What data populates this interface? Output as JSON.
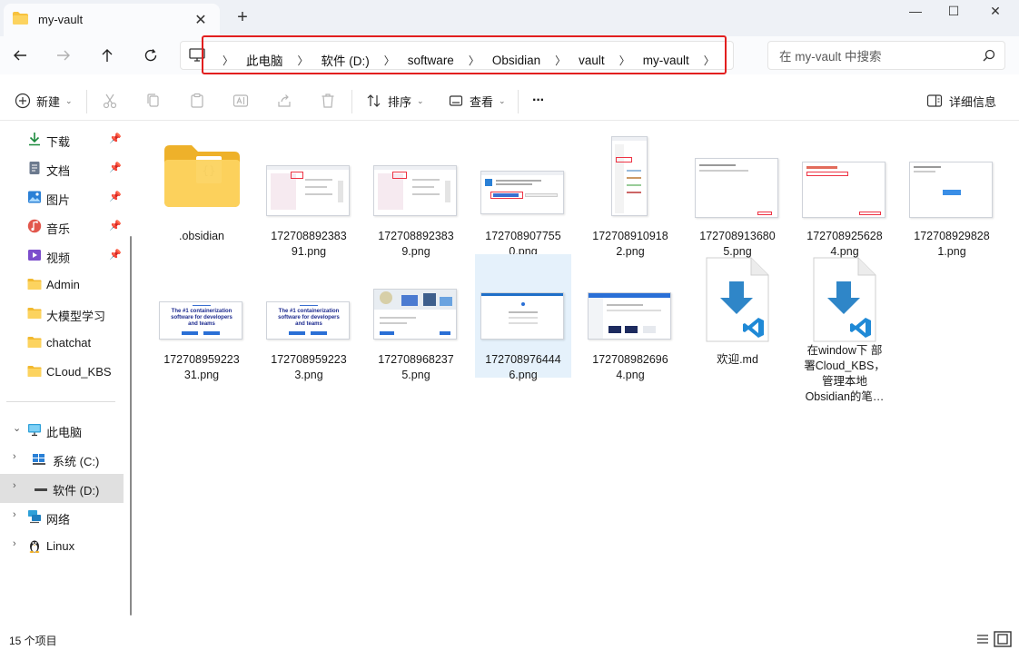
{
  "window": {
    "tab_title": "my-vault",
    "new_tab_symbol": "+",
    "close_symbol": "✕",
    "minimize_symbol": "—",
    "maximize_symbol": "☐"
  },
  "nav": {
    "back_icon": "arrow-left-icon",
    "forward_icon": "arrow-right-icon",
    "up_icon": "arrow-up-icon",
    "refresh_icon": "refresh-icon"
  },
  "breadcrumb": [
    "此电脑",
    "软件 (D:)",
    "software",
    "Obsidian",
    "vault",
    "my-vault"
  ],
  "search": {
    "placeholder": "在 my-vault 中搜索"
  },
  "toolbar": {
    "new_label": "新建",
    "sort_label": "排序",
    "view_label": "查看",
    "more_label": "···",
    "details_label": "详细信息"
  },
  "sidebar": {
    "quick_access": [
      {
        "label": "下载",
        "icon": "download-icon",
        "pinned": true
      },
      {
        "label": "文档",
        "icon": "document-icon",
        "pinned": true
      },
      {
        "label": "图片",
        "icon": "pictures-icon",
        "pinned": true
      },
      {
        "label": "音乐",
        "icon": "music-icon",
        "pinned": true
      },
      {
        "label": "视频",
        "icon": "video-icon",
        "pinned": true
      },
      {
        "label": "Admin",
        "icon": "folder-icon",
        "pinned": false
      },
      {
        "label": "大模型学习",
        "icon": "folder-icon",
        "pinned": false
      },
      {
        "label": "chatchat",
        "icon": "folder-icon",
        "pinned": false
      },
      {
        "label": "CLoud_KBS",
        "icon": "folder-icon",
        "pinned": false
      }
    ],
    "tree": [
      {
        "label": "此电脑",
        "icon": "computer-icon",
        "expanded": true
      },
      {
        "label": "系统 (C:)",
        "icon": "drive-icon"
      },
      {
        "label": "软件 (D:)",
        "icon": "drive-icon",
        "selected": true
      },
      {
        "label": "网络",
        "icon": "network-icon"
      },
      {
        "label": "Linux",
        "icon": "linux-icon"
      }
    ]
  },
  "files": [
    {
      "name": ".obsidian",
      "kind": "folder"
    },
    {
      "name": "17270889238391.png",
      "kind": "image"
    },
    {
      "name": "1727088923839.png",
      "kind": "image"
    },
    {
      "name": "1727089077550.png",
      "kind": "image"
    },
    {
      "name": "1727089109182.png",
      "kind": "image"
    },
    {
      "name": "1727089136805.png",
      "kind": "image"
    },
    {
      "name": "1727089256284.png",
      "kind": "image"
    },
    {
      "name": "1727089298281.png",
      "kind": "image"
    },
    {
      "name": "17270895922331.png",
      "kind": "image"
    },
    {
      "name": "1727089592233.png",
      "kind": "image"
    },
    {
      "name": "1727089682375.png",
      "kind": "image"
    },
    {
      "name": "1727089764446.png",
      "kind": "image",
      "selected": true
    },
    {
      "name": "1727089826964.png",
      "kind": "image"
    },
    {
      "name": "欢迎.md",
      "kind": "markdown"
    },
    {
      "name": "在window下 部署Cloud_KBS，管理本地Obsidian的笔…",
      "kind": "markdown"
    }
  ],
  "file_labels": {
    "f0": ".obsidian",
    "f1a": "172708892383",
    "f1b": "91.png",
    "f2a": "172708892383",
    "f2b": "9.png",
    "f3a": "172708907755",
    "f3b": "0.png",
    "f4a": "172708910918",
    "f4b": "2.png",
    "f5a": "172708913680",
    "f5b": "5.png",
    "f6a": "172708925628",
    "f6b": "4.png",
    "f7a": "172708929828",
    "f7b": "1.png",
    "f8a": "172708959223",
    "f8b": "31.png",
    "f9a": "172708959223",
    "f9b": "3.png",
    "f10a": "172708968237",
    "f10b": "5.png",
    "f11a": "172708976444",
    "f11b": "6.png",
    "f12a": "172708982696",
    "f12b": "4.png",
    "f13": "欢迎.md",
    "f14a": "在window下 部",
    "f14b": "署Cloud_KBS，",
    "f14c": "管理本地",
    "f14d": "Obsidian的笔…"
  },
  "status": {
    "item_count": "15 个项目"
  },
  "colors": {
    "accent_blue": "#0067c0",
    "highlight_red": "#e21f1f",
    "folder_yellow": "#f8c74a",
    "selection_blue": "#e5f1fb"
  }
}
